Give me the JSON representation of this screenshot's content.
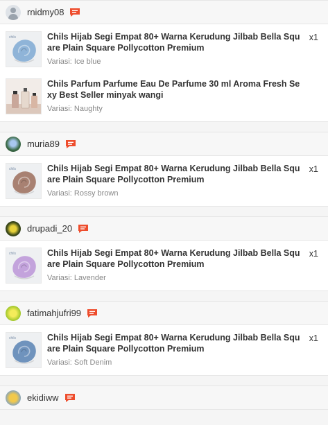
{
  "orders": [
    {
      "username": "rnidmy08",
      "avatar": "default",
      "items": [
        {
          "title": "Chils Hijab Segi Empat 80+ Warna Kerudung Jilbab Bella Square Plain Square Pollycotton Premium",
          "variant": "Variasi: Ice blue",
          "qty": "x1",
          "thumb": "scarf",
          "color": "#8fb4d8"
        },
        {
          "title": "Chils Parfum Parfume Eau De Parfume 30 ml Aroma Fresh Sexy Best Seller minyak wangi",
          "variant": "Variasi: Naughty",
          "qty": "",
          "thumb": "perfume",
          "color": "#c9a79a"
        }
      ]
    },
    {
      "username": "muria89",
      "avatar": "photo-blue",
      "items": [
        {
          "title": "Chils Hijab Segi Empat 80+ Warna Kerudung Jilbab Bella Square Plain Square Pollycotton Premium",
          "variant": "Variasi: Rossy brown",
          "qty": "x1",
          "thumb": "scarf",
          "color": "#a88172"
        }
      ]
    },
    {
      "username": "drupadi_20",
      "avatar": "photo-dark",
      "items": [
        {
          "title": "Chils Hijab Segi Empat 80+ Warna Kerudung Jilbab Bella Square Plain Square Pollycotton Premium",
          "variant": "Variasi: Lavender",
          "qty": "x1",
          "thumb": "scarf",
          "color": "#c3a3dc"
        }
      ]
    },
    {
      "username": "fatimahjufri99",
      "avatar": "photo-lime",
      "items": [
        {
          "title": "Chils Hijab Segi Empat 80+ Warna Kerudung Jilbab Bella Square Plain Square Pollycotton Premium",
          "variant": "Variasi: Soft Denim",
          "qty": "x1",
          "thumb": "scarf",
          "color": "#6f93bd"
        }
      ]
    },
    {
      "username": "ekidiww",
      "avatar": "photo-yellow",
      "items": []
    }
  ],
  "colors": {
    "chat_icon": "#ee4d2d"
  },
  "icons": {
    "chat": "chat-icon",
    "avatar": "avatar-icon"
  }
}
